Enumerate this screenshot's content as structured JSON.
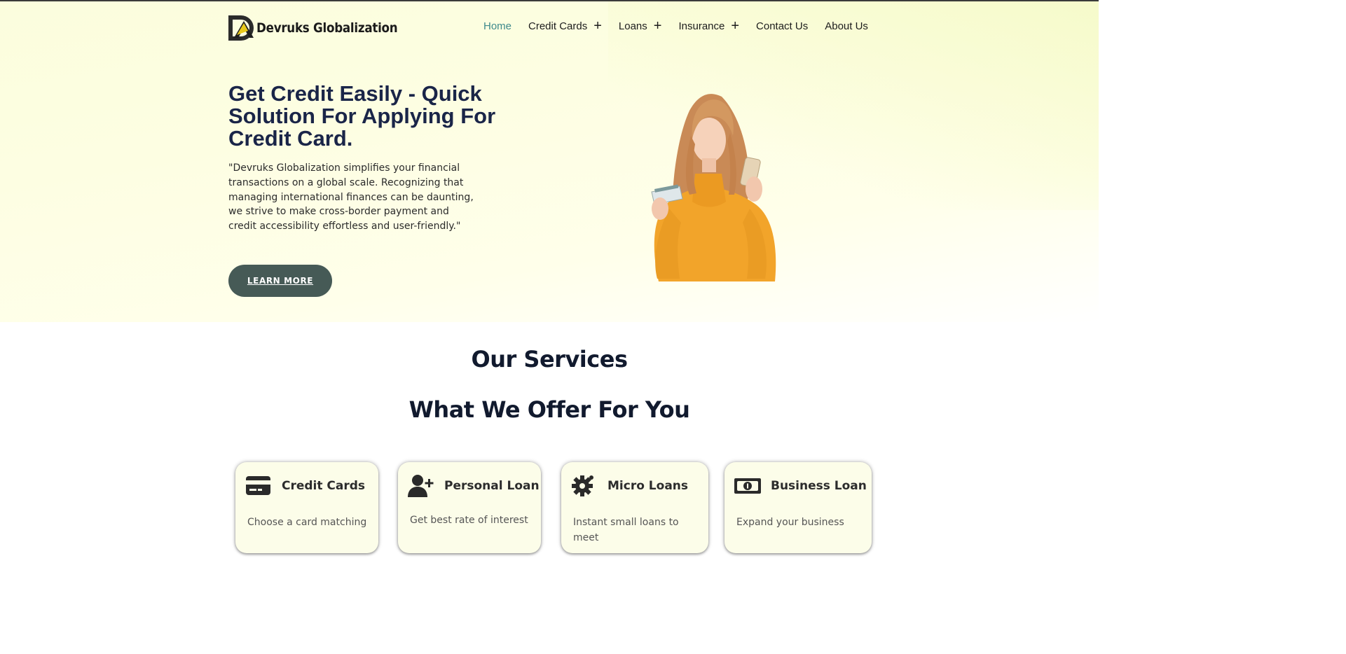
{
  "brand": {
    "name": "Devruks Globalization"
  },
  "nav": {
    "items": [
      {
        "label": "Home",
        "active": true,
        "has_submenu": false
      },
      {
        "label": "Credit Cards",
        "active": false,
        "has_submenu": true
      },
      {
        "label": "Loans",
        "active": false,
        "has_submenu": true
      },
      {
        "label": "Insurance",
        "active": false,
        "has_submenu": true
      },
      {
        "label": "Contact Us",
        "active": false,
        "has_submenu": false
      },
      {
        "label": "About Us",
        "active": false,
        "has_submenu": false
      }
    ],
    "submenu_icon": "+"
  },
  "hero": {
    "title": "Get Credit Easily - Quick Solution For Applying For Credit Card.",
    "description": "\"Devruks Globalization simplifies your financial transactions on a global scale. Recognizing that managing international finances can be daunting, we strive to make cross-border payment and credit accessibility effortless and user-friendly.\"",
    "button_label": "LEARN MORE"
  },
  "services": {
    "title": "Our Services",
    "subtitle": "What We Offer For You",
    "cards": [
      {
        "icon": "credit-card-icon",
        "title": "Credit Cards",
        "text": "Choose a card matching"
      },
      {
        "icon": "user-plus-icon",
        "title": "Personal Loan",
        "text": "Get best rate of interest"
      },
      {
        "icon": "gear-icon",
        "title": "Micro Loans",
        "text": "Instant small loans to meet"
      },
      {
        "icon": "money-bill-icon",
        "title": "Business Loan",
        "text": "Expand your business"
      }
    ]
  },
  "colors": {
    "accent": "#3e8a8c",
    "heading": "#1a2548",
    "button": "#465a56",
    "card_bg": "#fcfde9",
    "sweater": "#f2a42a"
  }
}
